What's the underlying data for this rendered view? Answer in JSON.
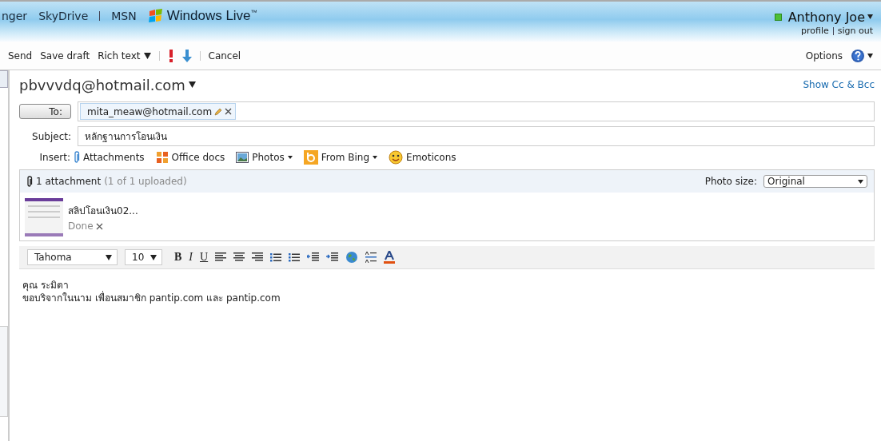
{
  "header": {
    "nav": [
      "nger",
      "SkyDrive",
      "MSN"
    ],
    "brand": "Windows Live",
    "brand_mark": "™",
    "user": {
      "name": "Anthony Joe",
      "online": true
    },
    "account_links": [
      "profile",
      "sign out"
    ]
  },
  "toolbar": {
    "left": [
      {
        "kind": "text",
        "label": "Send"
      },
      {
        "kind": "text",
        "label": "Save draft"
      },
      {
        "kind": "menu",
        "label": "Rich text"
      },
      {
        "kind": "sep"
      },
      {
        "kind": "high"
      },
      {
        "kind": "low"
      },
      {
        "kind": "sep"
      },
      {
        "kind": "text",
        "label": "Cancel"
      }
    ],
    "options": "Options"
  },
  "compose": {
    "from": "pbvvvdq@hotmail.com",
    "show_cc": "Show Cc & Bcc",
    "to_label": "To:",
    "recipients": [
      "mita_meaw@hotmail.com"
    ],
    "subject_label": "Subject:",
    "subject": "หลักฐานการโอนเงิน",
    "insert_label": "Insert:",
    "insert": [
      {
        "kind": "clip",
        "label": "Attachments",
        "menu": false
      },
      {
        "kind": "office",
        "label": "Office docs",
        "menu": false
      },
      {
        "kind": "photo",
        "label": "Photos",
        "menu": true
      },
      {
        "kind": "bing",
        "label": "From Bing",
        "menu": true
      },
      {
        "kind": "smile",
        "label": "Emoticons",
        "menu": false
      }
    ]
  },
  "attachments": {
    "count": "1 attachment",
    "status": "(1 of 1 uploaded)",
    "photo_size_label": "Photo size:",
    "photo_size": "Original",
    "files": [
      {
        "name": "สลิปโอนเงิน02...",
        "state": "Done"
      }
    ]
  },
  "format_bar": {
    "font": "Tahoma",
    "size": "10",
    "buttons": [
      {
        "kind": "bold",
        "label": "B"
      },
      {
        "kind": "italic",
        "label": "I"
      },
      {
        "kind": "underline",
        "label": "U"
      },
      {
        "kind": "align-left"
      },
      {
        "kind": "align-center"
      },
      {
        "kind": "align-right"
      },
      {
        "kind": "numbered"
      },
      {
        "kind": "bulleted"
      },
      {
        "kind": "outdent"
      },
      {
        "kind": "indent"
      },
      {
        "kind": "link"
      },
      {
        "kind": "spacing"
      },
      {
        "kind": "color"
      }
    ]
  },
  "body": [
    "คุณ ระมิตา",
    "ขอบริจากในนาม เพื่อนสมาชิก pantip.com และ pantip.com"
  ]
}
